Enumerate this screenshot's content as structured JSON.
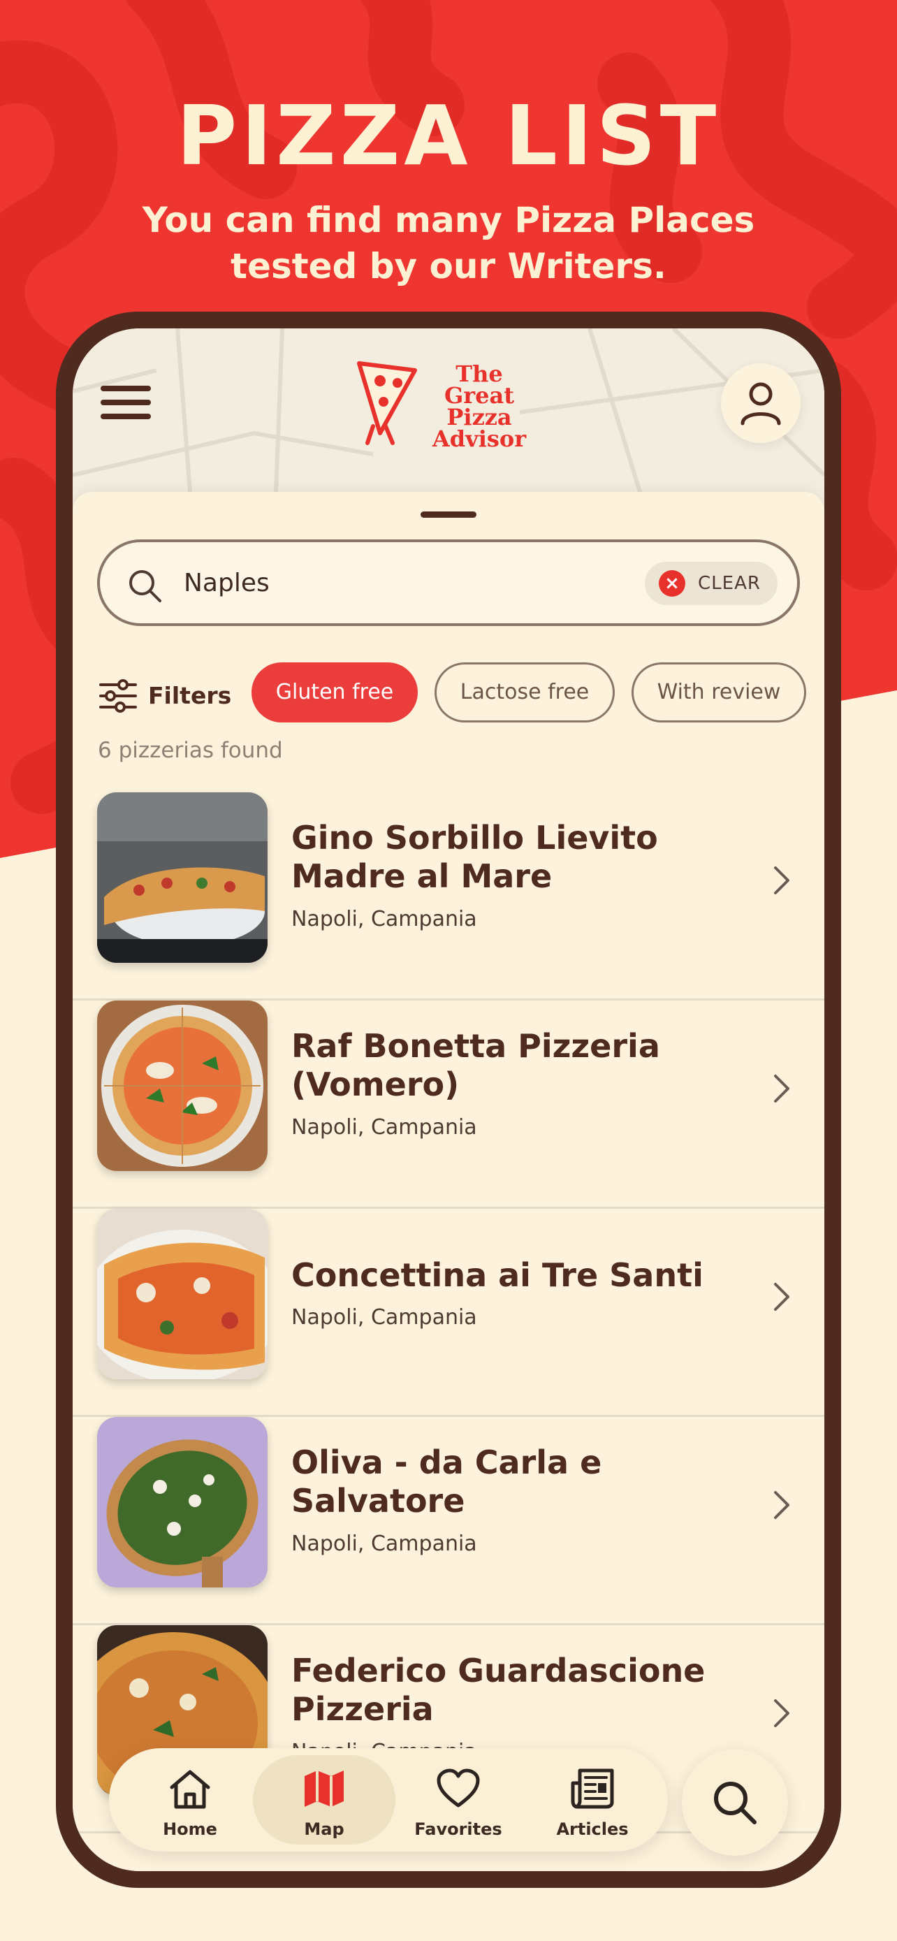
{
  "promo": {
    "headline": "PIZZA LIST",
    "subline_1": "You can find many Pizza Places",
    "subline_2": "tested by our Writers."
  },
  "header": {
    "logo_lines": [
      "The",
      "Great",
      "Pizza",
      "Advisor"
    ]
  },
  "search": {
    "value": "Naples",
    "clear_label": "CLEAR"
  },
  "filters": {
    "label": "Filters",
    "chips": [
      {
        "label": "Gluten free",
        "active": true
      },
      {
        "label": "Lactose free",
        "active": false
      },
      {
        "label": "With review",
        "active": false
      }
    ]
  },
  "results_count": "6 pizzerias found",
  "pizzerias": [
    {
      "name_1": "Gino Sorbillo Lievito",
      "name_2": "Madre al Mare",
      "location": "Napoli, Campania"
    },
    {
      "name_1": "Raf Bonetta Pizzeria",
      "name_2": "(Vomero)",
      "location": "Napoli, Campania"
    },
    {
      "name_1": "Concettina ai Tre Santi",
      "name_2": "",
      "location": "Napoli, Campania"
    },
    {
      "name_1": "Oliva - da Carla e",
      "name_2": "Salvatore",
      "location": "Napoli, Campania"
    },
    {
      "name_1": "Federico Guardascione",
      "name_2": "Pizzeria",
      "location": "Napoli, Campania"
    }
  ],
  "tabbar": {
    "tabs": [
      {
        "label": "Home",
        "icon": "home-icon"
      },
      {
        "label": "Map",
        "icon": "map-icon",
        "active": true
      },
      {
        "label": "Favorites",
        "icon": "heart-icon"
      },
      {
        "label": "Articles",
        "icon": "newspaper-icon"
      }
    ]
  },
  "colors": {
    "brand_red": "#ee3530",
    "cream": "#fdf3dc",
    "brown": "#4e2a1f"
  }
}
